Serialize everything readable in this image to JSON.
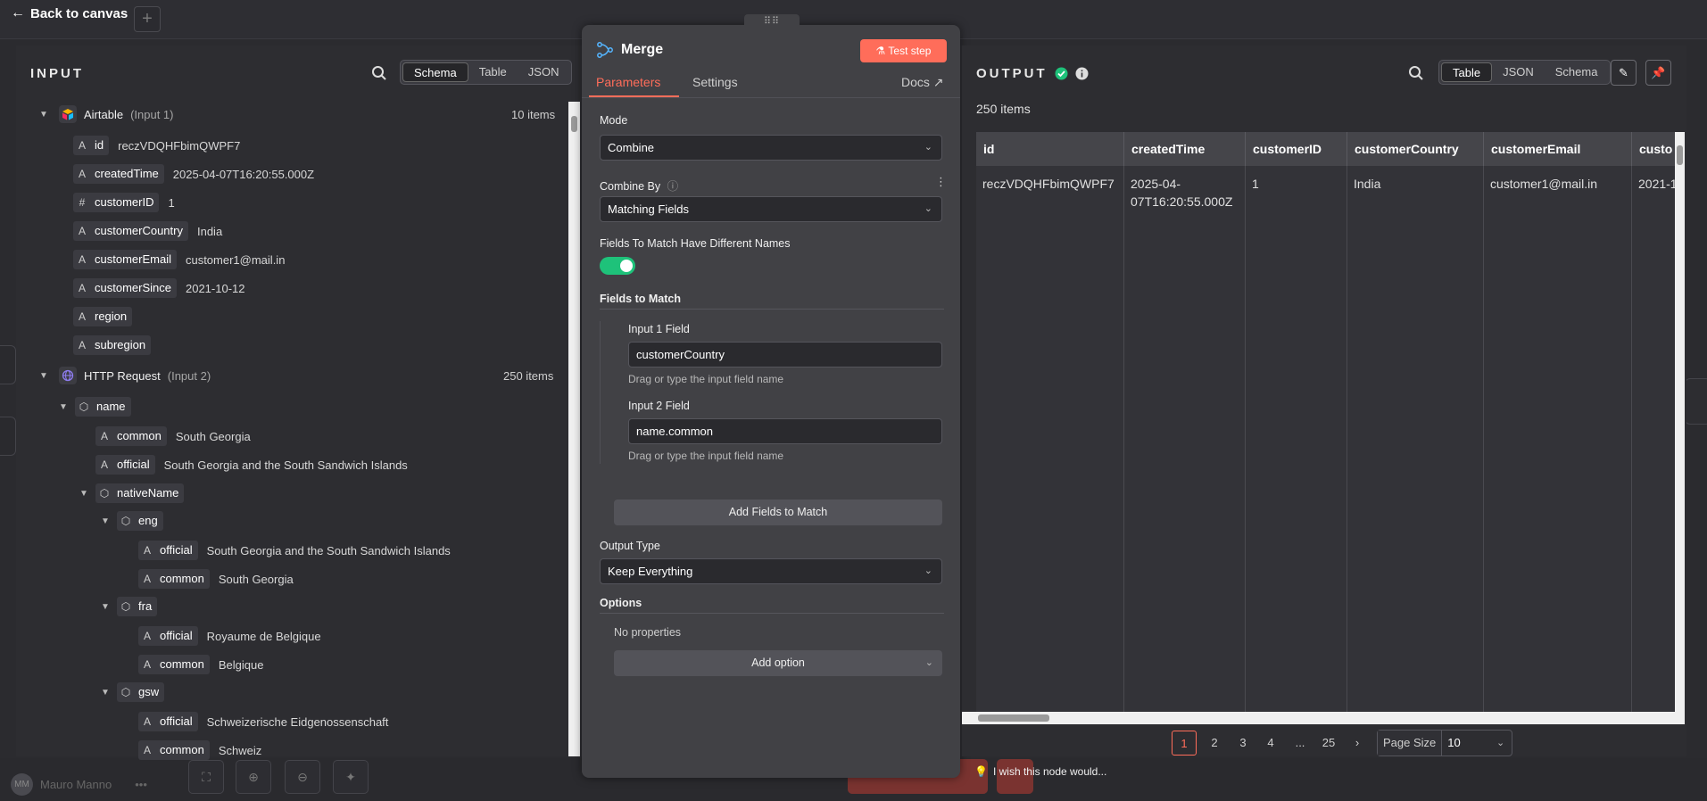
{
  "topbar": {
    "back_label": "Back to canvas",
    "plus": "+"
  },
  "bottombar": {
    "user_initials": "MM",
    "user_name": "Mauro Manno",
    "more": "•••",
    "wish_text": "I wish this node would..."
  },
  "input": {
    "title": "INPUT",
    "views": [
      "Schema",
      "Table",
      "JSON"
    ],
    "active_view": "Schema",
    "airtable": {
      "name": "Airtable",
      "sub": "(Input 1)",
      "count": "10 items"
    },
    "airtable_fields": [
      {
        "type": "A",
        "key": "id",
        "value": "reczVDQHFbimQWPF7"
      },
      {
        "type": "#",
        "key": "createdTime",
        "value": "2025-04-07T16:20:55.000Z",
        "type_override": "A"
      },
      {
        "type": "#",
        "key": "customerID",
        "value": "1"
      },
      {
        "type": "A",
        "key": "customerCountry",
        "value": "India"
      },
      {
        "type": "A",
        "key": "customerEmail",
        "value": "customer1@mail.in"
      },
      {
        "type": "A",
        "key": "customerSince",
        "value": "2021-10-12"
      },
      {
        "type": "A",
        "key": "region",
        "value": ""
      },
      {
        "type": "A",
        "key": "subregion",
        "value": ""
      }
    ],
    "http": {
      "name": "HTTP Request",
      "sub": "(Input 2)",
      "count": "250 items"
    },
    "http_tree": {
      "name": "name",
      "common_key": "common",
      "common_val": "South Georgia",
      "official_key": "official",
      "official_val": "South Georgia and the South Sandwich Islands",
      "nativeName": "nativeName",
      "eng": "eng",
      "eng_official": "South Georgia and the South Sandwich Islands",
      "eng_common": "South Georgia",
      "fra": "fra",
      "fra_official": "Royaume de Belgique",
      "fra_common": "Belgique",
      "gsw": "gsw",
      "gsw_official": "Schweizerische Eidgenossenschaft",
      "gsw_common": "Schweiz"
    }
  },
  "params": {
    "node_name": "Merge",
    "test_label": "Test step",
    "tabs": [
      "Parameters",
      "Settings"
    ],
    "docs_label": "Docs",
    "mode_label": "Mode",
    "mode_value": "Combine",
    "combine_by_label": "Combine By",
    "combine_by_value": "Matching Fields",
    "diff_names_label": "Fields To Match Have Different Names",
    "diff_names_on": true,
    "fields_to_match_label": "Fields to Match",
    "input1_label": "Input 1 Field",
    "input1_value": "customerCountry",
    "input1_hint": "Drag or type the input field name",
    "input2_label": "Input 2 Field",
    "input2_value": "name.common",
    "input2_hint": "Drag or type the input field name",
    "add_fields_label": "Add Fields to Match",
    "output_type_label": "Output Type",
    "output_type_value": "Keep Everything",
    "options_label": "Options",
    "no_props": "No properties",
    "add_option": "Add option"
  },
  "output": {
    "title": "OUTPUT",
    "views": [
      "Table",
      "JSON",
      "Schema"
    ],
    "active_view": "Table",
    "count": "250 items",
    "columns": [
      "id",
      "createdTime",
      "customerID",
      "customerCountry",
      "customerEmail",
      "custo"
    ],
    "row": [
      "reczVDQHFbimQWPF7",
      "2025-04-07T16:20:55.000Z",
      "1",
      "India",
      "customer1@mail.in",
      "2021-1"
    ],
    "row_created_line1": "2025-04-",
    "row_created_line2": "07T16:20:55.000Z",
    "pages": [
      "1",
      "2",
      "3",
      "4",
      "...",
      "25"
    ],
    "current_page": "1",
    "page_size_label": "Page Size",
    "page_size": "10"
  },
  "colors": {
    "accent": "#ff6d5a",
    "success": "#1ec27a",
    "panel": "#414145",
    "bg": "#2d2d31"
  }
}
